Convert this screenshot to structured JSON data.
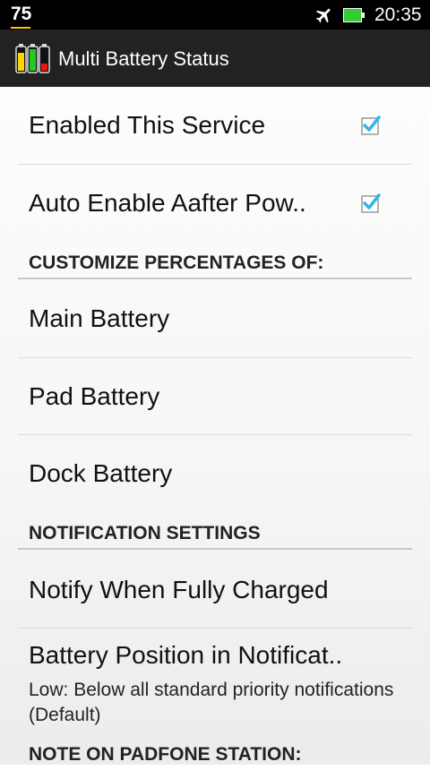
{
  "status_bar": {
    "left_indicator": "75",
    "time": "20:35",
    "icons": [
      "airplane-icon",
      "battery-icon"
    ],
    "battery_color": "#33cc33"
  },
  "action_bar": {
    "title": "Multi Battery Status",
    "icon": "multi-battery-app-icon"
  },
  "preferences": {
    "enabled_service": {
      "label": "Enabled This Service",
      "checked": true
    },
    "auto_enable": {
      "label": "Auto Enable Aafter Pow..",
      "checked": true
    },
    "category_customize": "CUSTOMIZE PERCENTAGES OF:",
    "main_battery": "Main Battery",
    "pad_battery": "Pad Battery",
    "dock_battery": "Dock Battery",
    "category_notification": "NOTIFICATION SETTINGS",
    "notify_full": "Notify When Fully Charged",
    "battery_position": {
      "label": "Battery Position in Notificat..",
      "summary": "Low:  Below all standard priority notifications (Default)"
    },
    "category_note": "NOTE ON PADFONE STATION:"
  },
  "colors": {
    "accent_check": "#33b5e5",
    "action_bar_bg": "#222222"
  }
}
